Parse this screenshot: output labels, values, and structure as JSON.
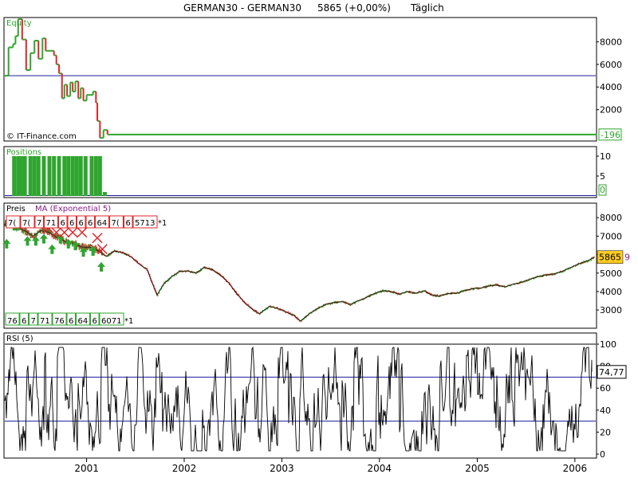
{
  "header": {
    "instrument": "GERMAN30 - GERMAN30",
    "last": "5865 (+0,00%)",
    "period": "Täglich"
  },
  "colors": {
    "up": "#2fa52f",
    "down": "#e0262a",
    "ref_line": "#1c1c9c",
    "frame": "#000000",
    "ma": "#8b1c8b",
    "price_tag_bg": "#ffcc22"
  },
  "chart_data": [
    {
      "type": "line",
      "panel": "equity",
      "title": "Equity",
      "watermark": "© IT-Finance.com",
      "reference_line": 5000,
      "ylim": [
        -700,
        10000
      ],
      "yticks": [
        "8000",
        "6000",
        "4000",
        "2000"
      ],
      "last_value_label": "-196",
      "series": [
        {
          "x": [
            "2000-03-01",
            "2000-03-15",
            "2000-04-01",
            "2000-04-10",
            "2000-04-20",
            "2000-05-05",
            "2000-05-20",
            "2000-06-05",
            "2000-06-20",
            "2000-07-05",
            "2000-07-20",
            "2000-08-01",
            "2000-08-15",
            "2000-09-01",
            "2000-09-10",
            "2000-09-20",
            "2000-10-01",
            "2000-10-10",
            "2000-10-20",
            "2000-11-01",
            "2000-11-10",
            "2000-11-20",
            "2000-12-01",
            "2000-12-10",
            "2000-12-20",
            "2001-01-01",
            "2001-01-15",
            "2001-01-25",
            "2001-02-05",
            "2001-02-10",
            "2001-02-20",
            "2001-03-05",
            "2001-03-20",
            "2006-03-25"
          ],
          "y": [
            5000,
            7500,
            7800,
            8500,
            10000,
            8200,
            5500,
            7000,
            8100,
            6500,
            8300,
            7200,
            7200,
            6800,
            6000,
            5200,
            3000,
            4200,
            3200,
            4400,
            3600,
            4500,
            3000,
            3900,
            2800,
            3300,
            3300,
            3600,
            2600,
            1000,
            -500,
            200,
            -196,
            -196
          ]
        }
      ]
    },
    {
      "type": "bar",
      "panel": "positions",
      "title": "Positions",
      "ylim": [
        0,
        12
      ],
      "yticks": [
        "10",
        "5"
      ],
      "last_value_label": "0",
      "bars": [
        {
          "x": "2000-04-05",
          "v": 10
        },
        {
          "x": "2000-04-20",
          "v": 10
        },
        {
          "x": "2000-05-01",
          "v": 10
        },
        {
          "x": "2000-05-15",
          "v": 10
        },
        {
          "x": "2000-06-05",
          "v": 10
        },
        {
          "x": "2000-06-20",
          "v": 10
        },
        {
          "x": "2000-07-05",
          "v": 10
        },
        {
          "x": "2000-07-25",
          "v": 10
        },
        {
          "x": "2000-08-15",
          "v": 10
        },
        {
          "x": "2000-09-01",
          "v": 10
        },
        {
          "x": "2000-09-20",
          "v": 10
        },
        {
          "x": "2000-10-10",
          "v": 10
        },
        {
          "x": "2000-10-25",
          "v": 10
        },
        {
          "x": "2000-11-10",
          "v": 10
        },
        {
          "x": "2000-11-25",
          "v": 10
        },
        {
          "x": "2000-12-10",
          "v": 10
        },
        {
          "x": "2000-12-28",
          "v": 10
        },
        {
          "x": "2001-01-20",
          "v": 10
        },
        {
          "x": "2001-02-05",
          "v": 10
        },
        {
          "x": "2001-02-20",
          "v": 10
        },
        {
          "x": "2001-03-10",
          "v": 1
        }
      ]
    },
    {
      "type": "line",
      "panel": "price",
      "title": "Preis",
      "indicator_label": "MA (Exponential 5)",
      "ylim": [
        2100,
        8700
      ],
      "yticks": [
        "8000",
        "7000",
        "6000",
        "5000",
        "4000",
        "3000"
      ],
      "last_price_label": "5865",
      "right_edge_label": "9",
      "series": [
        {
          "x": [
            "2000-03-01",
            "2000-03-15",
            "2000-04-01",
            "2000-04-20",
            "2000-05-15",
            "2000-06-15",
            "2000-07-15",
            "2000-08-15",
            "2000-09-15",
            "2000-10-15",
            "2000-11-15",
            "2000-12-15",
            "2001-01-15",
            "2001-02-15",
            "2001-03-15",
            "2001-04-15",
            "2001-05-15",
            "2001-06-15",
            "2001-07-15",
            "2001-08-15",
            "2001-09-05",
            "2001-09-21",
            "2001-10-15",
            "2001-11-15",
            "2001-12-15",
            "2002-01-15",
            "2002-02-15",
            "2002-03-15",
            "2002-04-15",
            "2002-05-15",
            "2002-06-15",
            "2002-07-15",
            "2002-08-15",
            "2002-09-15",
            "2002-10-10",
            "2002-11-15",
            "2002-12-15",
            "2003-01-15",
            "2003-02-15",
            "2003-03-12",
            "2003-04-15",
            "2003-05-15",
            "2003-06-15",
            "2003-07-15",
            "2003-08-15",
            "2003-09-15",
            "2003-10-15",
            "2003-11-15",
            "2003-12-15",
            "2004-01-15",
            "2004-02-15",
            "2004-03-15",
            "2004-04-15",
            "2004-05-15",
            "2004-06-15",
            "2004-07-15",
            "2004-08-15",
            "2004-09-15",
            "2004-10-15",
            "2004-11-15",
            "2004-12-15",
            "2005-01-15",
            "2005-02-15",
            "2005-03-15",
            "2005-04-15",
            "2005-05-15",
            "2005-06-15",
            "2005-07-15",
            "2005-08-15",
            "2005-09-15",
            "2005-10-15",
            "2005-11-15",
            "2005-12-15",
            "2006-01-15",
            "2006-02-15",
            "2006-03-15"
          ],
          "y": [
            7600,
            7900,
            7600,
            7400,
            7300,
            7000,
            7300,
            7200,
            6900,
            6700,
            6600,
            6400,
            6400,
            6200,
            5900,
            6200,
            6100,
            5900,
            5500,
            5200,
            4400,
            3800,
            4400,
            4800,
            5100,
            5100,
            5000,
            5300,
            5200,
            4900,
            4500,
            3900,
            3400,
            3000,
            2800,
            3200,
            3100,
            2900,
            2700,
            2400,
            2800,
            3100,
            3300,
            3400,
            3450,
            3300,
            3500,
            3700,
            3900,
            4050,
            4000,
            3850,
            4000,
            3900,
            4050,
            3800,
            3750,
            3900,
            3900,
            4050,
            4150,
            4200,
            4300,
            4350,
            4250,
            4400,
            4500,
            4650,
            4800,
            4900,
            4950,
            5100,
            5300,
            5500,
            5650,
            5865
          ]
        }
      ],
      "entry_markers": [
        {
          "x": "2000-03-08",
          "y": 6550,
          "type": "buy"
        },
        {
          "x": "2000-04-05",
          "y": 7520,
          "type": "buy"
        },
        {
          "x": "2000-04-20",
          "y": 7520,
          "type": "buy"
        },
        {
          "x": "2000-05-25",
          "y": 6700,
          "type": "buy"
        },
        {
          "x": "2000-06-25",
          "y": 6700,
          "type": "buy"
        },
        {
          "x": "2000-07-25",
          "y": 6820,
          "type": "buy"
        },
        {
          "x": "2000-08-25",
          "y": 6250,
          "type": "buy"
        },
        {
          "x": "2000-09-25",
          "y": 6820,
          "type": "buy"
        },
        {
          "x": "2000-10-25",
          "y": 6550,
          "type": "buy"
        },
        {
          "x": "2000-11-20",
          "y": 6450,
          "type": "buy"
        },
        {
          "x": "2000-12-20",
          "y": 6100,
          "type": "buy"
        },
        {
          "x": "2001-01-25",
          "y": 6150,
          "type": "buy"
        },
        {
          "x": "2001-02-25",
          "y": 5300,
          "type": "buy"
        }
      ],
      "exit_markers": [
        {
          "x": "2000-08-10",
          "y": 7450,
          "type": "sell"
        },
        {
          "x": "2000-09-10",
          "y": 7200,
          "type": "sell"
        },
        {
          "x": "2000-10-10",
          "y": 7200,
          "type": "sell"
        },
        {
          "x": "2000-11-10",
          "y": 7200,
          "type": "sell"
        },
        {
          "x": "2000-12-15",
          "y": 7200,
          "type": "sell"
        },
        {
          "x": "2001-02-10",
          "y": 6900,
          "type": "sell"
        },
        {
          "x": "2001-03-01",
          "y": 6300,
          "type": "sell"
        }
      ],
      "top_labels": [
        "7(",
        "7(",
        "7",
        "71",
        "6",
        "6",
        "6",
        "6",
        "64",
        "7(",
        "6",
        "5713",
        "*1"
      ],
      "bottom_labels": [
        "76",
        "6",
        "7",
        "71",
        "76",
        "6",
        "64",
        "6",
        "6071",
        "*1"
      ]
    },
    {
      "type": "line",
      "panel": "rsi",
      "title": "RSI (5)",
      "ylim": [
        0,
        100
      ],
      "yticks": [
        "100",
        "80",
        "60",
        "40",
        "20",
        "0"
      ],
      "reference_lines": [
        70,
        30
      ],
      "last_value_label": "74,77",
      "series": [
        {
          "x": [
            "2000-03-01",
            "2006-03-15"
          ],
          "y": [
            50,
            74.77
          ]
        }
      ]
    }
  ],
  "x_axis": {
    "ticks": [
      {
        "label": "2001",
        "date": "2001-01-01"
      },
      {
        "label": "2002",
        "date": "2002-01-01"
      },
      {
        "label": "2003",
        "date": "2003-01-01"
      },
      {
        "label": "2004",
        "date": "2004-01-01"
      },
      {
        "label": "2005",
        "date": "2005-01-01"
      },
      {
        "label": "2006",
        "date": "2006-01-01"
      }
    ]
  }
}
